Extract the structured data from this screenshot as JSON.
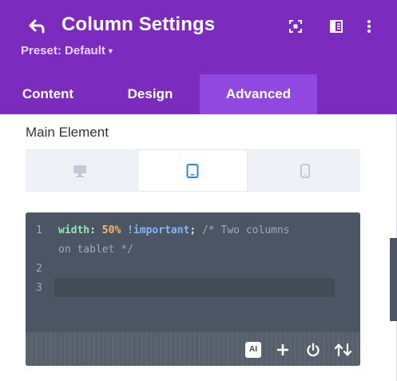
{
  "header": {
    "title": "Column Settings",
    "preset_label": "Preset: Default",
    "caret": "▾",
    "accent_color": "#7b2cbf",
    "icons": [
      "back-arrow-icon",
      "focus-icon",
      "sidebar-layout-icon",
      "more-vertical-icon"
    ]
  },
  "tabs": [
    {
      "label": "Content",
      "active": false
    },
    {
      "label": "Design",
      "active": false
    },
    {
      "label": "Advanced",
      "active": true
    }
  ],
  "section": {
    "label": "Main Element",
    "devices": [
      {
        "name": "desktop",
        "icon": "desktop-icon",
        "active": false
      },
      {
        "name": "tablet",
        "icon": "tablet-icon",
        "active": true
      },
      {
        "name": "phone",
        "icon": "phone-icon",
        "active": false
      }
    ]
  },
  "editor": {
    "line_numbers": [
      "1",
      "2",
      "3"
    ],
    "line1": {
      "prop": "width",
      "colon": ":",
      "value": "50%",
      "important": "!important",
      "semicolon": ";",
      "comment_part1": "/* Two columns",
      "comment_part2": "on tablet */"
    },
    "toolbar": {
      "ai_label": "AI",
      "icons": [
        "ai-icon",
        "plus-icon",
        "power-icon",
        "sort-arrows-icon"
      ]
    }
  }
}
